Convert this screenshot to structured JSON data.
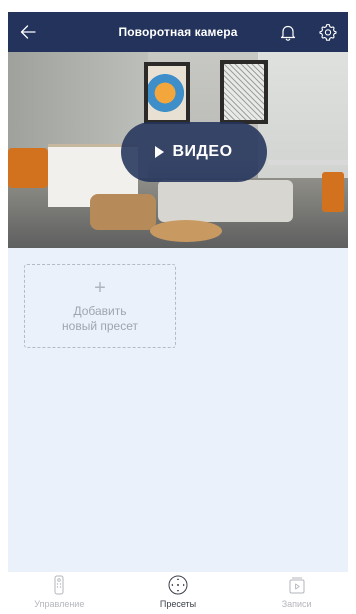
{
  "header": {
    "title": "Поворотная камера",
    "back_icon": "arrow-left-icon",
    "bell_icon": "bell-icon",
    "settings_icon": "gear-icon",
    "background": "#23335b"
  },
  "video": {
    "button_label": "ВИДЕО",
    "button_icon": "play-icon"
  },
  "presets": {
    "add_icon": "plus-icon",
    "add_label_line1": "Добавить",
    "add_label_line2": "новый пресет"
  },
  "bottom_nav": {
    "items": [
      {
        "label": "Управление",
        "icon": "remote-control-icon",
        "active": false
      },
      {
        "label": "Пресеты",
        "icon": "presets-dial-icon",
        "active": true
      },
      {
        "label": "Записи",
        "icon": "recordings-icon",
        "active": false
      }
    ]
  },
  "colors": {
    "accent": "#23335b",
    "content_bg": "#eaf1fb",
    "inactive_text": "#b3b6bb",
    "active_text": "#3a3f49"
  }
}
